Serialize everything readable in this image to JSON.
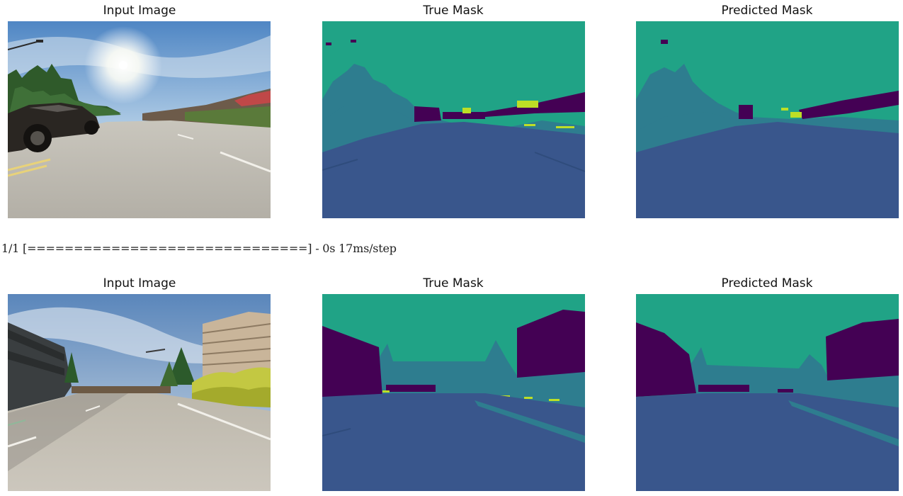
{
  "figures": [
    {
      "panels": [
        {
          "title": "Input Image",
          "kind": "photo",
          "scene": "street-with-car-sun"
        },
        {
          "title": "True Mask",
          "kind": "segmentation-mask"
        },
        {
          "title": "Predicted Mask",
          "kind": "segmentation-mask"
        }
      ]
    },
    {
      "panels": [
        {
          "title": "Input Image",
          "kind": "photo",
          "scene": "street-with-building-trees"
        },
        {
          "title": "True Mask",
          "kind": "segmentation-mask"
        },
        {
          "title": "Predicted Mask",
          "kind": "segmentation-mask"
        }
      ]
    }
  ],
  "log": {
    "text": "1/1 [==============================] - 0s 17ms/step"
  },
  "colors": {
    "sky_class": "#20a386",
    "road_class": "#39568c",
    "vegetation_class": "#2e7d8f",
    "building_class": "#440154",
    "lane_class": "#bddf26"
  }
}
